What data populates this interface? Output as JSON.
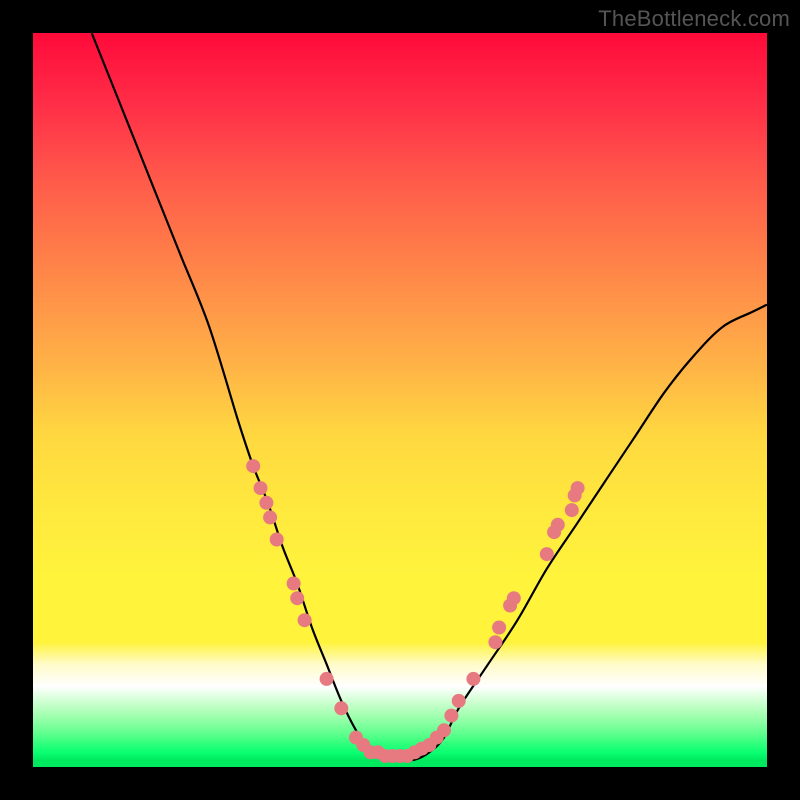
{
  "watermark": "TheBottleneck.com",
  "colors": {
    "frame": "#000000",
    "curve": "#000000",
    "dot": "#e67a80"
  },
  "chart_data": {
    "type": "line",
    "title": "",
    "xlabel": "",
    "ylabel": "",
    "xlim": [
      0,
      100
    ],
    "ylim": [
      0,
      100
    ],
    "series": [
      {
        "name": "bottleneck-curve",
        "x": [
          8,
          12,
          16,
          20,
          24,
          28,
          30,
          32,
          34,
          36,
          38,
          40,
          42,
          44,
          46,
          48,
          50,
          52,
          54,
          56,
          58,
          62,
          66,
          70,
          74,
          78,
          82,
          86,
          90,
          94,
          98,
          100
        ],
        "y": [
          100,
          90,
          80,
          70,
          60,
          47,
          41,
          36,
          30,
          25,
          19,
          14,
          9,
          5,
          2,
          1,
          1,
          1,
          2,
          4,
          8,
          14,
          20,
          27,
          33,
          39,
          45,
          51,
          56,
          60,
          62,
          63
        ]
      }
    ],
    "annotations": {
      "dots": [
        {
          "x": 30.0,
          "y": 41
        },
        {
          "x": 31.0,
          "y": 38
        },
        {
          "x": 31.8,
          "y": 36
        },
        {
          "x": 32.3,
          "y": 34
        },
        {
          "x": 33.2,
          "y": 31
        },
        {
          "x": 35.5,
          "y": 25
        },
        {
          "x": 36.0,
          "y": 23
        },
        {
          "x": 37.0,
          "y": 20
        },
        {
          "x": 40.0,
          "y": 12
        },
        {
          "x": 42.0,
          "y": 8
        },
        {
          "x": 44.0,
          "y": 4
        },
        {
          "x": 45.0,
          "y": 3
        },
        {
          "x": 46.0,
          "y": 2
        },
        {
          "x": 47.0,
          "y": 2
        },
        {
          "x": 48.0,
          "y": 1.5
        },
        {
          "x": 49.0,
          "y": 1.5
        },
        {
          "x": 50.0,
          "y": 1.5
        },
        {
          "x": 51.0,
          "y": 1.5
        },
        {
          "x": 52.0,
          "y": 2
        },
        {
          "x": 53.0,
          "y": 2.5
        },
        {
          "x": 54.0,
          "y": 3
        },
        {
          "x": 55.0,
          "y": 4
        },
        {
          "x": 56.0,
          "y": 5
        },
        {
          "x": 57.0,
          "y": 7
        },
        {
          "x": 58.0,
          "y": 9
        },
        {
          "x": 60.0,
          "y": 12
        },
        {
          "x": 63.0,
          "y": 17
        },
        {
          "x": 63.5,
          "y": 19
        },
        {
          "x": 65.0,
          "y": 22
        },
        {
          "x": 65.5,
          "y": 23
        },
        {
          "x": 70.0,
          "y": 29
        },
        {
          "x": 71.0,
          "y": 32
        },
        {
          "x": 71.5,
          "y": 33
        },
        {
          "x": 73.4,
          "y": 35
        },
        {
          "x": 73.8,
          "y": 37
        },
        {
          "x": 74.2,
          "y": 38
        }
      ]
    }
  }
}
